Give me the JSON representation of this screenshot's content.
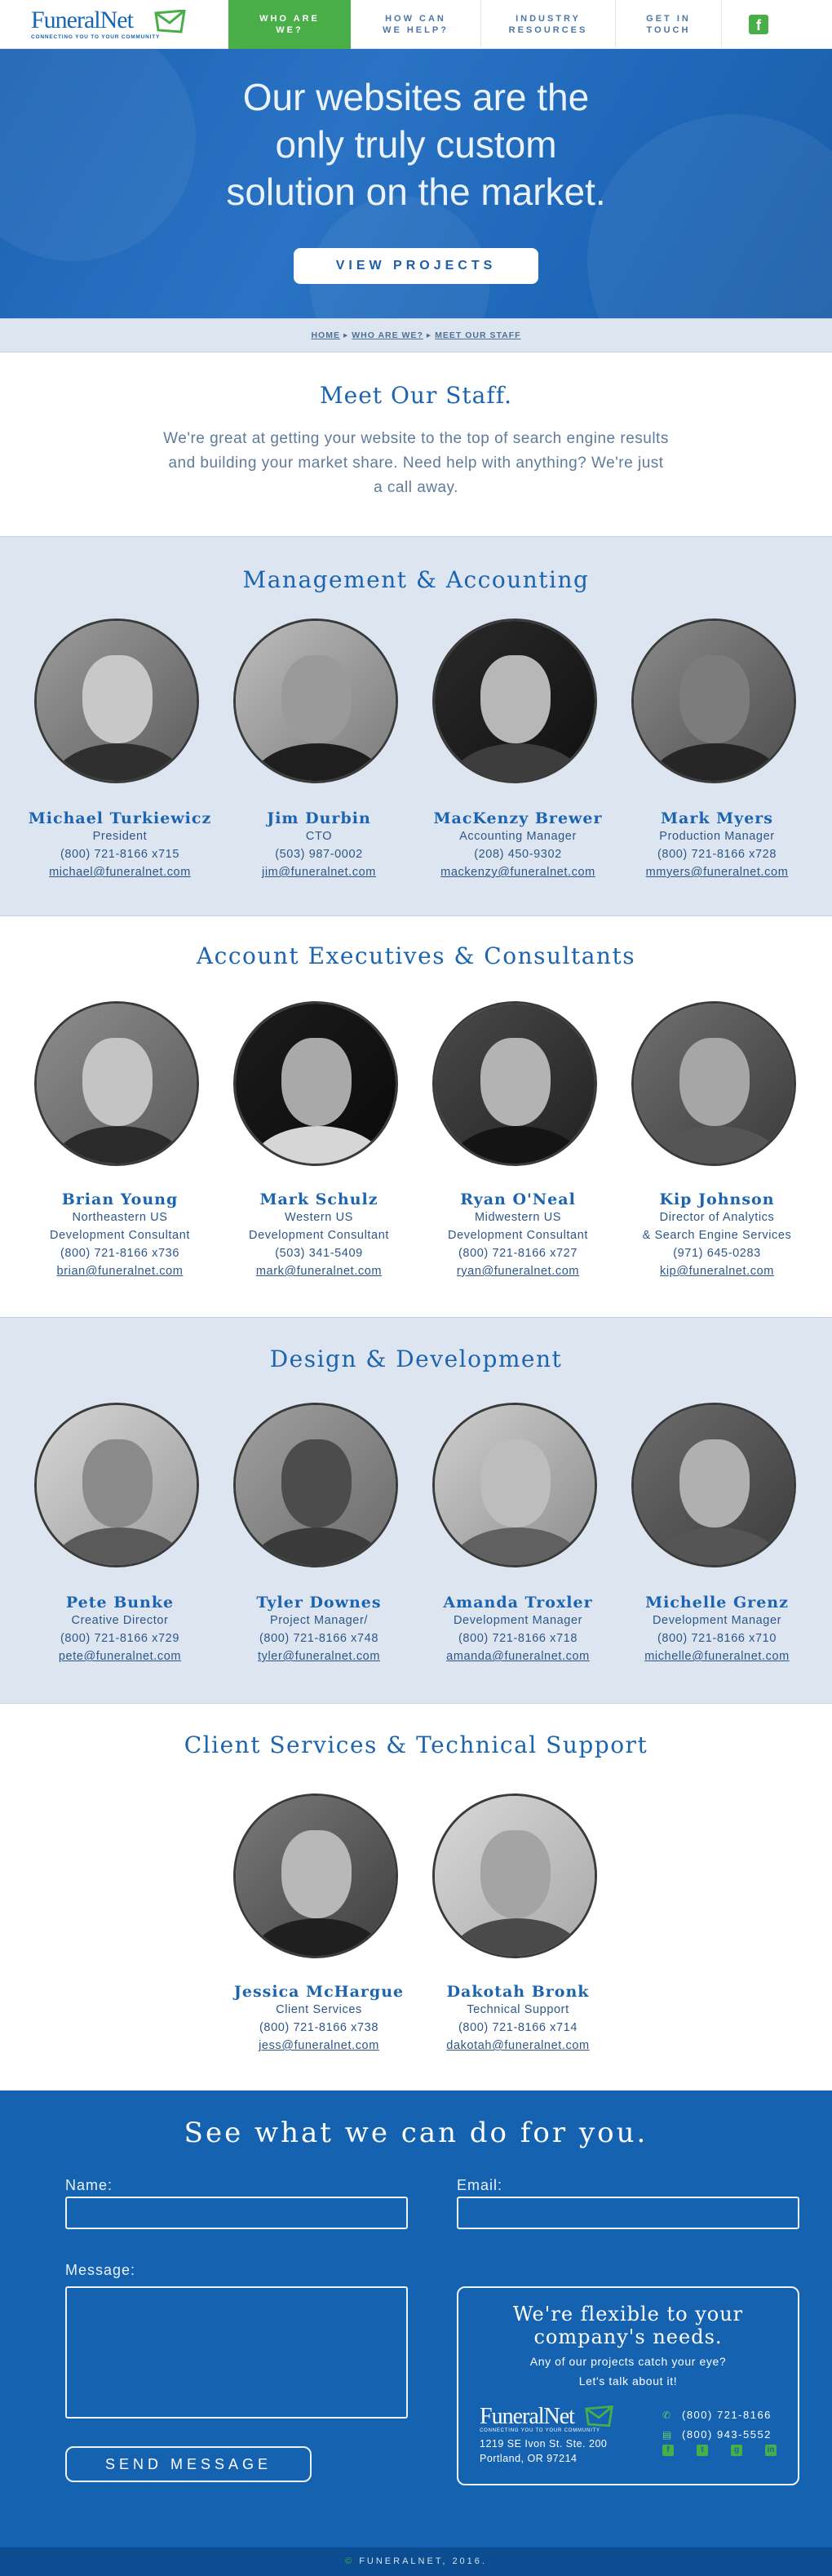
{
  "header": {
    "logo_text": "FuneralNet",
    "logo_tagline": "CONNECTING YOU TO YOUR COMMUNITY",
    "nav": [
      {
        "line1": "WHO ARE",
        "line2": "WE?"
      },
      {
        "line1": "HOW CAN",
        "line2": "WE HELP?"
      },
      {
        "line1": "INDUSTRY",
        "line2": "RESOURCES"
      },
      {
        "line1": "GET IN",
        "line2": "TOUCH"
      }
    ],
    "facebook_icon": "f"
  },
  "hero": {
    "line1": "Our websites are the",
    "line2": "only truly custom",
    "line3": "solution on the market.",
    "button": "VIEW PROJECTS"
  },
  "breadcrumb": {
    "home": "HOME",
    "who": "WHO ARE WE?",
    "staff": "MEET OUR STAFF"
  },
  "intro": {
    "title": "Meet Our Staff.",
    "text": "We're great at getting your website to the top of search engine results and building your market share. Need help with anything? We're just a call away."
  },
  "sections": [
    {
      "title": "Management & Accounting",
      "people": [
        {
          "name": "Michael Turkiewicz",
          "lines": [
            "President",
            "(800) 721-8166 x715"
          ],
          "email": "michael@funeralnet.com"
        },
        {
          "name": "Jim Durbin",
          "lines": [
            "CTO",
            "(503) 987-0002"
          ],
          "email": "jim@funeralnet.com"
        },
        {
          "name": "MacKenzy Brewer",
          "lines": [
            "Accounting Manager",
            "(208) 450-9302"
          ],
          "email": "mackenzy@funeralnet.com"
        },
        {
          "name": "Mark Myers",
          "lines": [
            "Production Manager",
            "(800) 721-8166 x728"
          ],
          "email": "mmyers@funeralnet.com"
        }
      ]
    },
    {
      "title": "Account Executives & Consultants",
      "people": [
        {
          "name": "Brian Young",
          "lines": [
            "Northeastern US",
            "Development Consultant",
            "(800) 721-8166 x736"
          ],
          "email": "brian@funeralnet.com"
        },
        {
          "name": "Mark Schulz",
          "lines": [
            "Western US",
            "Development Consultant",
            "(503) 341-5409"
          ],
          "email": "mark@funeralnet.com"
        },
        {
          "name": "Ryan O'Neal",
          "lines": [
            "Midwestern US",
            "Development Consultant",
            "(800) 721-8166 x727"
          ],
          "email": "ryan@funeralnet.com"
        },
        {
          "name": "Kip Johnson",
          "lines": [
            "Director of Analytics",
            "& Search Engine Services",
            "(971) 645-0283"
          ],
          "email": "kip@funeralnet.com"
        }
      ]
    },
    {
      "title": "Design & Development",
      "people": [
        {
          "name": "Pete Bunke",
          "lines": [
            "Creative Director",
            "(800) 721-8166 x729"
          ],
          "email": "pete@funeralnet.com"
        },
        {
          "name": "Tyler Downes",
          "lines": [
            "Project Manager/",
            "(800) 721-8166 x748"
          ],
          "email": "tyler@funeralnet.com"
        },
        {
          "name": "Amanda Troxler",
          "lines": [
            "Development Manager",
            "(800) 721-8166 x718"
          ],
          "email": "amanda@funeralnet.com"
        },
        {
          "name": "Michelle Grenz",
          "lines": [
            "Development Manager",
            "(800) 721-8166 x710"
          ],
          "email": "michelle@funeralnet.com"
        }
      ]
    },
    {
      "title": "Client Services & Technical Support",
      "people": [
        {
          "name": "Jessica McHargue",
          "lines": [
            "Client Services",
            "(800) 721-8166 x738"
          ],
          "email": "jess@funeralnet.com"
        },
        {
          "name": "Dakotah Bronk",
          "lines": [
            "Technical Support",
            "(800) 721-8166 x714"
          ],
          "email": "dakotah@funeralnet.com"
        }
      ]
    }
  ],
  "contact": {
    "title": "See what we can do for you.",
    "name_label": "Name:",
    "email_label": "Email:",
    "message_label": "Message:",
    "send": "SEND MESSAGE",
    "card_title1": "We're flexible to your",
    "card_title2": "company's needs.",
    "card_sub1": "Any of our projects catch your eye?",
    "card_sub2": "Let's talk about it!",
    "logo_text": "FuneralNet",
    "logo_tagline": "CONNECTING YOU TO YOUR COMMUNITY",
    "address1": "1219 SE Ivon St. Ste. 200",
    "address2": "Portland, OR 97214",
    "phone": "(800) 721-8166",
    "fax": "(800) 943-5552",
    "social_icons": [
      "facebook-icon",
      "twitter-icon",
      "google-plus-icon",
      "linkedin-icon"
    ]
  },
  "footer": {
    "copyright_symbol": "©",
    "text": "FUNERALNET, 2016."
  }
}
